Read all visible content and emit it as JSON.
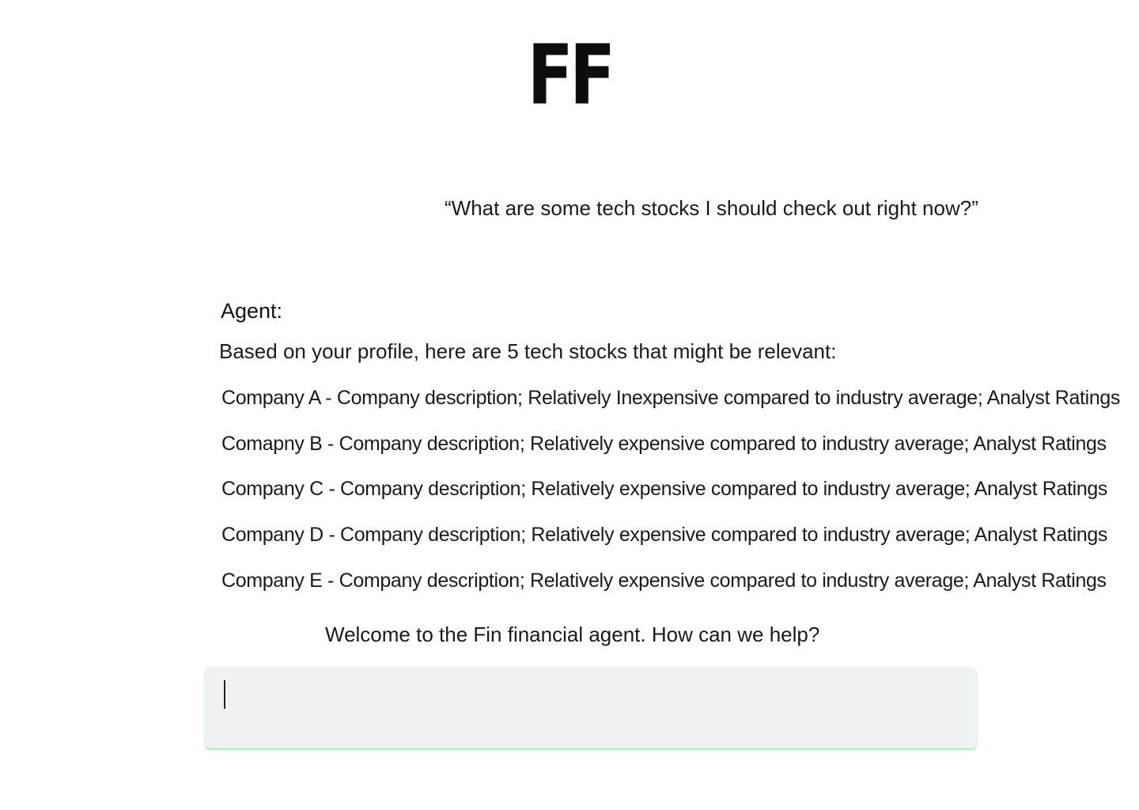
{
  "logo": {
    "text": "FF"
  },
  "conversation": {
    "user_query": "“What are some tech stocks I should check out right now?”",
    "agent_label": "Agent:",
    "agent_intro": "Based on your profile, here are 5 tech stocks that might be relevant:",
    "stocks": [
      "Company A - Company description; Relatively Inexpensive compared to industry average; Analyst Ratings",
      "Comapny B - Company description; Relatively expensive compared to industry average; Analyst Ratings",
      "Company C - Company description; Relatively expensive compared to industry average;  Analyst Ratings",
      "Company D - Company description; Relatively expensive compared to industry average; Analyst Ratings",
      "Company E - Company description; Relatively expensive compared to industry average; Analyst Ratings"
    ]
  },
  "welcome": {
    "text": "Welcome to the Fin financial agent. How can we help?"
  },
  "chat_input": {
    "value": "",
    "placeholder": ""
  },
  "colors": {
    "input_background": "#eff2f2",
    "input_accent": "#a6e8bb",
    "text": "#1a1a1a"
  }
}
